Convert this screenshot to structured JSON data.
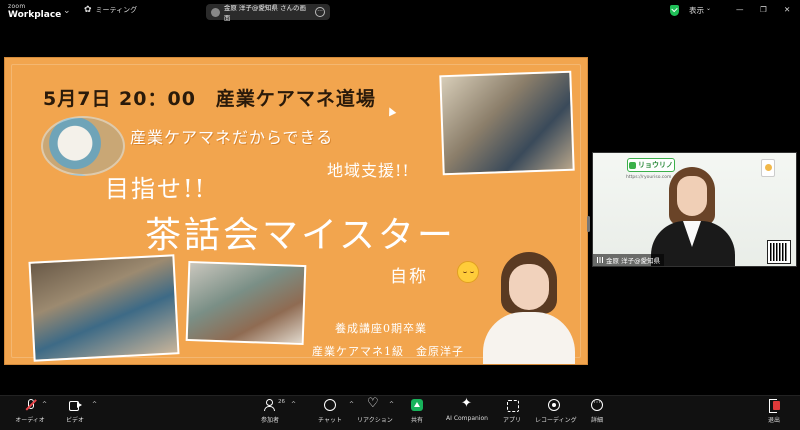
{
  "app": {
    "brand_top": "zoom",
    "brand_bottom": "Workplace"
  },
  "header": {
    "meeting_label": "ミーティング",
    "share_label": "金原 洋子@愛知県 さんの画面",
    "view_label": "表示",
    "colors": {
      "shield": "#1fbf57"
    }
  },
  "slide": {
    "headline": "5月7日 20：00　産業ケアマネ道場",
    "subtitle1": "産業ケアマネだからできる",
    "subtitle2": "地域支援!!",
    "aim": "目指せ!!",
    "big_title": "茶話会マイスター",
    "self_called": "自称",
    "credit1": "養成講座0期卒業",
    "credit2": "産業ケアマネ1級　金原洋子",
    "background": "#f2a54e"
  },
  "video": {
    "logo_text": "リョウリノ",
    "url_text": "https://ryouriso.com",
    "participant_name": "金原 洋子@愛知県"
  },
  "toolbar": {
    "audio": "オーディオ",
    "video": "ビデオ",
    "participants": "参加者",
    "participants_count": "26",
    "chat": "チャット",
    "reactions": "リアクション",
    "share": "共有",
    "ai_companion": "AI Companion",
    "apps": "アプリ",
    "record": "レコーディング",
    "more": "詳細",
    "leave": "退出"
  }
}
